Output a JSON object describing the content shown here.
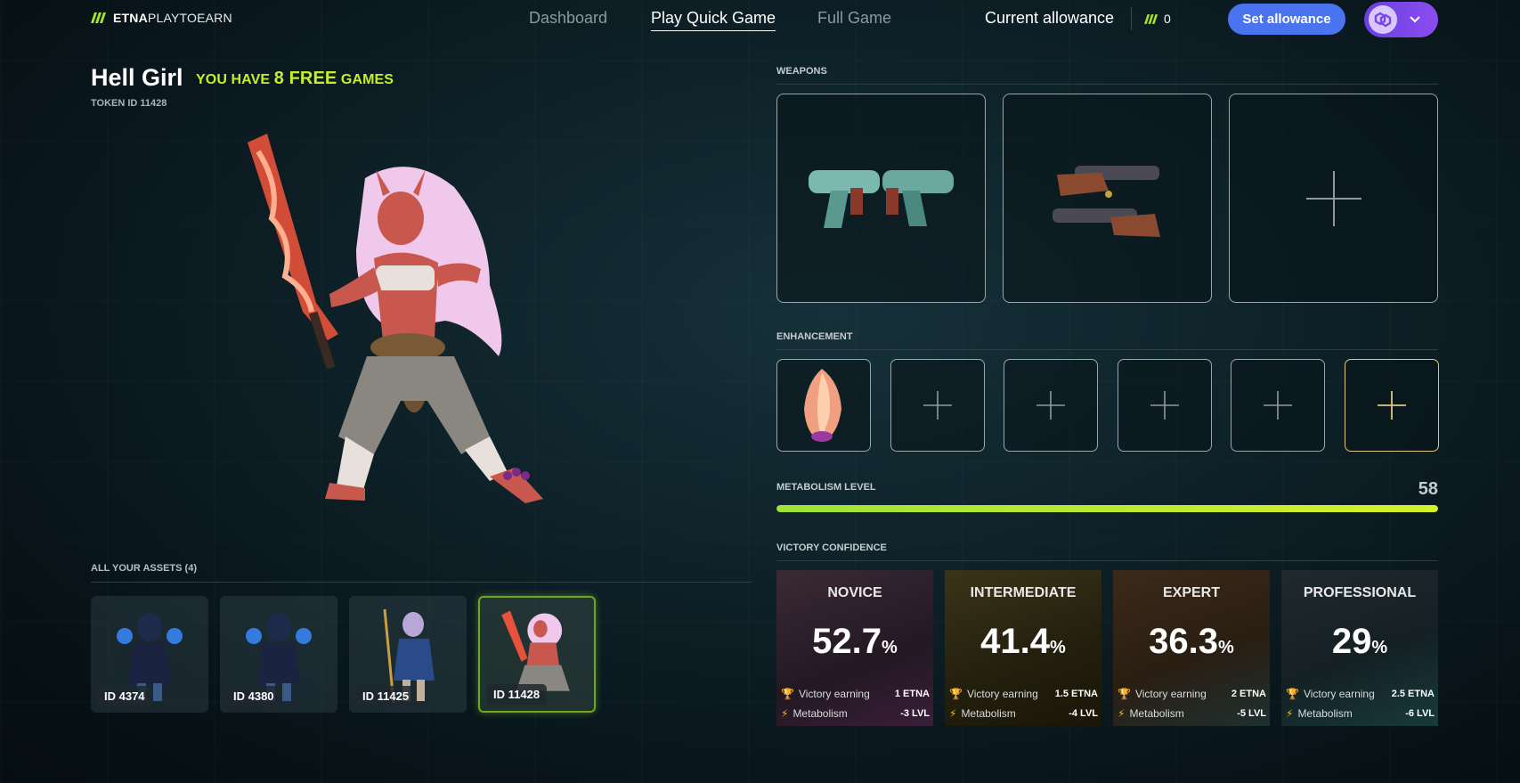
{
  "header": {
    "logo_bold": "ETNA",
    "logo_thin": "PLAYTOEARN",
    "nav": [
      {
        "label": "Dashboard"
      },
      {
        "label": "Play Quick Game"
      },
      {
        "label": "Full Game"
      }
    ],
    "allowance_label": "Current allowance",
    "allowance_value": "0",
    "set_allowance": "Set allowance"
  },
  "hero": {
    "name": "Hell Girl",
    "free_prefix": "YOU HAVE",
    "free_count": "8 FREE",
    "free_suffix": "GAMES",
    "token_id": "TOKEN ID 11428"
  },
  "assets": {
    "title": "ALL YOUR ASSETS (4)",
    "items": [
      {
        "id": "ID 4374"
      },
      {
        "id": "ID 4380"
      },
      {
        "id": "ID 11425"
      },
      {
        "id": "ID 11428"
      }
    ]
  },
  "weapons": {
    "title": "WEAPONS"
  },
  "enhancement": {
    "title": "ENHANCEMENT"
  },
  "metabolism": {
    "title": "METABOLISM LEVEL",
    "value": "58",
    "level_fraction": 0.58
  },
  "victory": {
    "title": "VICTORY CONFIDENCE",
    "cards": [
      {
        "level": "NOVICE",
        "pct": "52.7",
        "unit": "%",
        "earn_label": "Victory earning",
        "earn": "1 ETNA",
        "meta_label": "Metabolism",
        "meta": "-3 LVL"
      },
      {
        "level": "INTERMEDIATE",
        "pct": "41.4",
        "unit": "%",
        "earn_label": "Victory earning",
        "earn": "1.5 ETNA",
        "meta_label": "Metabolism",
        "meta": "-4 LVL"
      },
      {
        "level": "EXPERT",
        "pct": "36.3",
        "unit": "%",
        "earn_label": "Victory earning",
        "earn": "2 ETNA",
        "meta_label": "Metabolism",
        "meta": "-5 LVL"
      },
      {
        "level": "PROFESSIONAL",
        "pct": "29",
        "unit": "%",
        "earn_label": "Victory earning",
        "earn": "2.5 ETNA",
        "meta_label": "Metabolism",
        "meta": "-6 LVL"
      }
    ]
  },
  "colors": {
    "accent": "#c6ee2a",
    "button": "#4a73f0",
    "wallet": "#7b45e8"
  }
}
